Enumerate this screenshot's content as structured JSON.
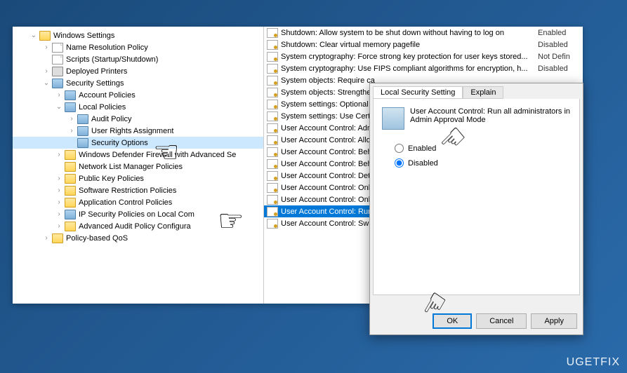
{
  "tree": [
    {
      "lvl": 1,
      "exp": "v",
      "icon": "folder",
      "label": "Windows Settings"
    },
    {
      "lvl": 2,
      "exp": ">",
      "icon": "doc",
      "label": "Name Resolution Policy"
    },
    {
      "lvl": 2,
      "exp": "",
      "icon": "doc",
      "label": "Scripts (Startup/Shutdown)"
    },
    {
      "lvl": 2,
      "exp": ">",
      "icon": "printer",
      "label": "Deployed Printers"
    },
    {
      "lvl": 2,
      "exp": "v",
      "icon": "folder-shield",
      "label": "Security Settings"
    },
    {
      "lvl": 3,
      "exp": ">",
      "icon": "folder-shield",
      "label": "Account Policies"
    },
    {
      "lvl": 3,
      "exp": "v",
      "icon": "folder-shield",
      "label": "Local Policies"
    },
    {
      "lvl": 4,
      "exp": ">",
      "icon": "folder-shield",
      "label": "Audit Policy"
    },
    {
      "lvl": 4,
      "exp": ">",
      "icon": "folder-shield",
      "label": "User Rights Assignment"
    },
    {
      "lvl": 4,
      "exp": "",
      "icon": "folder-shield",
      "label": "Security Options",
      "sel": true
    },
    {
      "lvl": 3,
      "exp": ">",
      "icon": "folder",
      "label": "Windows Defender Firewall with Advanced Se"
    },
    {
      "lvl": 3,
      "exp": "",
      "icon": "folder",
      "label": "Network List Manager Policies"
    },
    {
      "lvl": 3,
      "exp": ">",
      "icon": "folder",
      "label": "Public Key Policies"
    },
    {
      "lvl": 3,
      "exp": ">",
      "icon": "folder",
      "label": "Software Restriction Policies"
    },
    {
      "lvl": 3,
      "exp": ">",
      "icon": "folder",
      "label": "Application Control Policies"
    },
    {
      "lvl": 3,
      "exp": ">",
      "icon": "folder-shield",
      "label": "IP Security Policies on Local Com"
    },
    {
      "lvl": 3,
      "exp": ">",
      "icon": "folder",
      "label": "Advanced Audit Policy Configura"
    },
    {
      "lvl": 2,
      "exp": ">",
      "icon": "folder",
      "label": "Policy-based QoS"
    }
  ],
  "list": [
    {
      "name": "Shutdown: Allow system to be shut down without having to log on",
      "status": "Enabled"
    },
    {
      "name": "Shutdown: Clear virtual memory pagefile",
      "status": "Disabled"
    },
    {
      "name": "System cryptography: Force strong key protection for user keys stored...",
      "status": "Not Defin"
    },
    {
      "name": "System cryptography: Use FIPS compliant algorithms for encryption, h...",
      "status": "Disabled"
    },
    {
      "name": "System objects: Require ca",
      "status": ""
    },
    {
      "name": "System objects: Strengther",
      "status": ""
    },
    {
      "name": "System settings: Optional s",
      "status": ""
    },
    {
      "name": "System settings: Use Certif",
      "status": ""
    },
    {
      "name": "User Account Control: Adr",
      "status": ""
    },
    {
      "name": "User Account Control: Allo",
      "status": ""
    },
    {
      "name": "User Account Control: Beh",
      "status": ""
    },
    {
      "name": "User Account Control: Beh",
      "status": ""
    },
    {
      "name": "User Account Control: Det",
      "status": ""
    },
    {
      "name": "User Account Control: Onl",
      "status": ""
    },
    {
      "name": "User Account Control: Onl",
      "status": ""
    },
    {
      "name": "User Account Control: Run",
      "status": "",
      "sel": true
    },
    {
      "name": "User Account Control: Swit",
      "status": ""
    }
  ],
  "dialog": {
    "tabs": {
      "active": "Local Security Setting",
      "other": "Explain"
    },
    "title": "User Account Control: Run all administrators in Admin Approval Mode",
    "options": {
      "enabled": "Enabled",
      "disabled": "Disabled"
    },
    "buttons": {
      "ok": "OK",
      "cancel": "Cancel",
      "apply": "Apply"
    }
  },
  "watermark": "UGETFIX"
}
